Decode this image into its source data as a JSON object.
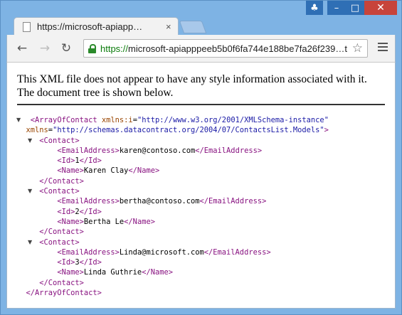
{
  "window": {
    "controls": {
      "user": "♣",
      "minimize": "–",
      "maximize": "□",
      "close": "✕"
    }
  },
  "tab": {
    "title": "https://microsoft-apiapp…",
    "close": "×"
  },
  "toolbar": {
    "back": "←",
    "forward": "→",
    "reload": "↻",
    "url_scheme": "https://",
    "url_rest": "microsoft-apiapppeeb5b0f6fa744e188be7fa26f239…t",
    "star": "☆"
  },
  "page": {
    "info_text": "This XML file does not appear to have any style information associated with it. The document tree is shown below.",
    "xml": {
      "root_open_tag": "<ArrayOfContact",
      "root_attr1_name": "xmlns:i",
      "root_attr1_value": "\"http://www.w3.org/2001/XMLSchema-instance\"",
      "root_attr2_name": "xmlns",
      "root_attr2_value": "\"http://schemas.datacontract.org/2004/07/ContactsList.Models\"",
      "root_close": "</ArrayOfContact>",
      "contact_open": "<Contact>",
      "contact_close": "</Contact>",
      "contacts": [
        {
          "email": "karen@contoso.com",
          "id": "1",
          "name": "Karen Clay"
        },
        {
          "email": "bertha@contoso.com",
          "id": "2",
          "name": "Bertha Le"
        },
        {
          "email": "Linda@microsoft.com",
          "id": "3",
          "name": "Linda Guthrie"
        }
      ],
      "email_open": "<EmailAddress>",
      "email_close": "</EmailAddress>",
      "id_open": "<Id>",
      "id_close": "</Id>",
      "name_open": "<Name>",
      "name_close": "</Name>"
    }
  }
}
